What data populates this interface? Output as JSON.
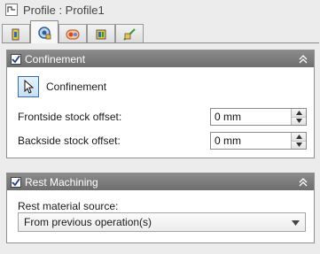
{
  "title": "Profile : Profile1",
  "tabs": [
    {
      "icon": "machine-icon",
      "active": false
    },
    {
      "icon": "tool-icon",
      "active": true
    },
    {
      "icon": "link-icon",
      "active": false
    },
    {
      "icon": "layers-icon",
      "active": false
    },
    {
      "icon": "path-icon",
      "active": false
    }
  ],
  "confinement": {
    "header": "Confinement",
    "checked": true,
    "button_label": "Confinement",
    "frontside_label": "Frontside stock offset:",
    "frontside_value": "0 mm",
    "backside_label": "Backside stock offset:",
    "backside_value": "0 mm"
  },
  "rest": {
    "header": "Rest Machining",
    "checked": true,
    "source_label": "Rest material source:",
    "source_value": "From previous operation(s)"
  }
}
